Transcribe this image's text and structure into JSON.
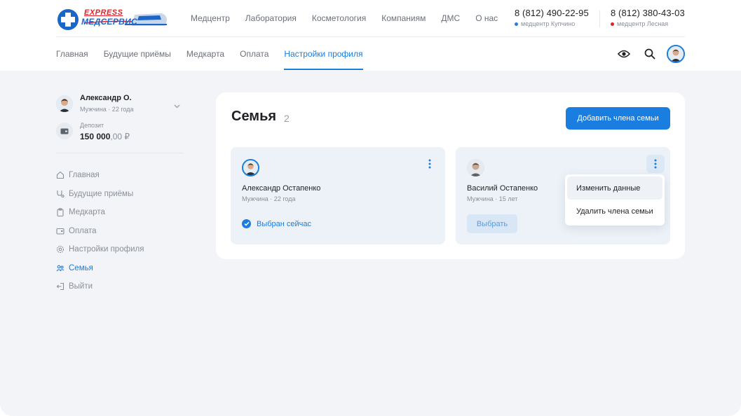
{
  "brand": {
    "logo_express": "EXPRESS",
    "logo_name": "МЕДСЕРВИС",
    "colors": {
      "accent": "#1a7de0",
      "logo_red": "#e0232a",
      "logo_blue": "#1b66c9"
    }
  },
  "topnav": [
    "Медцентр",
    "Лаборатория",
    "Косметология",
    "Компаниям",
    "ДМС",
    "О нас"
  ],
  "phones": [
    {
      "number": "8 (812) 490-22-95",
      "center": "медцентр Купчино",
      "dot_color": "#2b7be0"
    },
    {
      "number": "8 (812) 380-43-03",
      "center": "медцентр Лесная",
      "dot_color": "#e0232a"
    }
  ],
  "subnav": {
    "items": [
      "Главная",
      "Будущие приёмы",
      "Медкарта",
      "Оплата",
      "Настройки профиля"
    ],
    "active": "Настройки профиля"
  },
  "header_icons": [
    "eye-icon",
    "search-icon",
    "user-avatar"
  ],
  "user": {
    "name": "Александр О.",
    "meta": "Мужчина · 22 года",
    "deposit_label": "Депозит",
    "deposit_int": "150 000",
    "deposit_dec": ",00 ₽"
  },
  "sidebar": {
    "items": [
      {
        "label": "Главная",
        "icon": "home-icon"
      },
      {
        "label": "Будущие приёмы",
        "icon": "stethoscope-icon"
      },
      {
        "label": "Медкарта",
        "icon": "clipboard-icon"
      },
      {
        "label": "Оплата",
        "icon": "wallet-icon"
      },
      {
        "label": "Настройки профиля",
        "icon": "gear-icon"
      },
      {
        "label": "Семья",
        "icon": "family-icon"
      },
      {
        "label": "Выйти",
        "icon": "logout-icon"
      }
    ],
    "active": "Семья"
  },
  "main": {
    "title": "Семья",
    "count": "2",
    "add_button": "Добавить члена семьи",
    "members": [
      {
        "name": "Александр Остапенко",
        "meta": "Мужчина · 22 года",
        "status": "Выбран сейчас"
      },
      {
        "name": "Василий Остапенко",
        "meta": "Мужчина · 15 лет",
        "action": "Выбрать"
      }
    ],
    "menu": [
      "Изменить данные",
      "Удалить члена семьи"
    ]
  }
}
